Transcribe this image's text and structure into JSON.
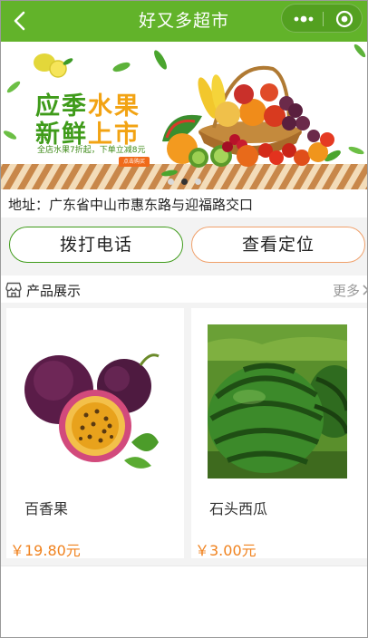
{
  "header": {
    "title": "好又多超市",
    "bg_color": "#62b32a",
    "back_icon": "chevron-left-icon",
    "more_icon": "more-dots-icon",
    "close_icon": "target-circle-icon"
  },
  "banner": {
    "line1_a": "应季",
    "line1_b": "水果",
    "line2_a": "新鲜",
    "line2_b": "上市",
    "subtitle": "全店水果7折起，下单立减8元",
    "button": "点击购买",
    "slide_count": 3,
    "active_slide": 1
  },
  "address": {
    "text": "地址：广东省中山市惠东路与迎福路交口"
  },
  "actions": {
    "call_label": "拨打电话",
    "locate_label": "查看定位"
  },
  "section": {
    "title": "产品展示",
    "more_label": "更多",
    "icon": "shop-icon"
  },
  "products": [
    {
      "name": "百香果",
      "price": "￥19.80元",
      "image": "passion-fruit-image"
    },
    {
      "name": "石头西瓜",
      "price": "￥3.00元",
      "image": "watermelon-image"
    }
  ],
  "colors": {
    "accent_green": "#62b32a",
    "price_orange": "#f0821e",
    "locate_border": "#f0a06a"
  }
}
